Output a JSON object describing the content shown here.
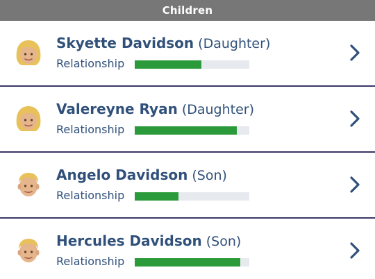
{
  "header": {
    "title": "Children"
  },
  "children": [
    {
      "name": "Skyette Davidson",
      "relation": "(Daughter)",
      "relationship_label": "Relationship",
      "relationship_level": 0.58,
      "avatar": "female-blonde-avatar-icon"
    },
    {
      "name": "Valereyne Ryan",
      "relation": "(Daughter)",
      "relationship_label": "Relationship",
      "relationship_level": 0.89,
      "avatar": "female-blonde-avatar-icon"
    },
    {
      "name": "Angelo Davidson",
      "relation": "(Son)",
      "relationship_label": "Relationship",
      "relationship_level": 0.38,
      "avatar": "male-blonde-avatar-icon"
    },
    {
      "name": "Hercules Davidson",
      "relation": "(Son)",
      "relationship_label": "Relationship",
      "relationship_level": 0.92,
      "avatar": "male-blonde-avatar-icon"
    }
  ],
  "colors": {
    "header_bg": "#777777",
    "text": "#30507a",
    "bar_fill": "#2b9a3a",
    "bar_track": "#e6e9ee",
    "divider": "#3a3666"
  }
}
